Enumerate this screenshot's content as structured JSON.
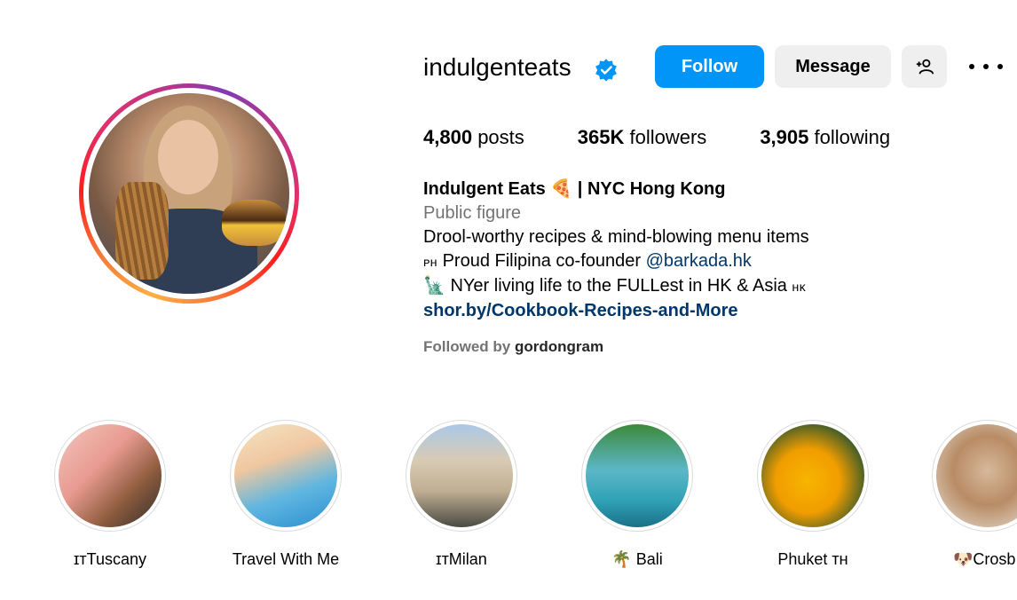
{
  "profile": {
    "username": "indulgenteats",
    "verified": true,
    "buttons": {
      "follow": "Follow",
      "message": "Message",
      "add_user_icon": "add-user-icon",
      "more_icon": "more-options-icon"
    },
    "stats": {
      "posts_count": "4,800",
      "posts_label": "posts",
      "followers_count": "365K",
      "followers_label": "followers",
      "following_count": "3,905",
      "following_label": "following"
    },
    "bio": {
      "name": "Indulgent Eats 🍕 | NYC Hong Kong",
      "category": "Public figure",
      "line1": "Drool-worthy recipes & mind-blowing menu items",
      "line2_prefix_flag": "ᴘʜ",
      "line2_text": " Proud Filipina co-founder ",
      "line2_mention": "@barkada.hk",
      "line3_emoji": "🗽",
      "line3_text": "  NYer living life to the FULLest in HK & Asia ",
      "line3_suffix_flag": "ʜᴋ",
      "link": "shor.by/Cookbook-Recipes-and-More"
    },
    "followed_by": {
      "prefix": "Followed by ",
      "user": "gordongram"
    }
  },
  "highlights": [
    {
      "label": "ɪᴛTuscany"
    },
    {
      "label": "Travel With Me"
    },
    {
      "label": "ɪᴛMilan"
    },
    {
      "label": "🌴 Bali"
    },
    {
      "label": "Phuket ᴛʜ"
    },
    {
      "label": "🐶Crosb"
    }
  ],
  "colors": {
    "follow_button": "#0095f6",
    "secondary_button": "#efefef",
    "link": "#00376b",
    "muted_text": "#737373",
    "verified_badge": "#0095f6"
  }
}
